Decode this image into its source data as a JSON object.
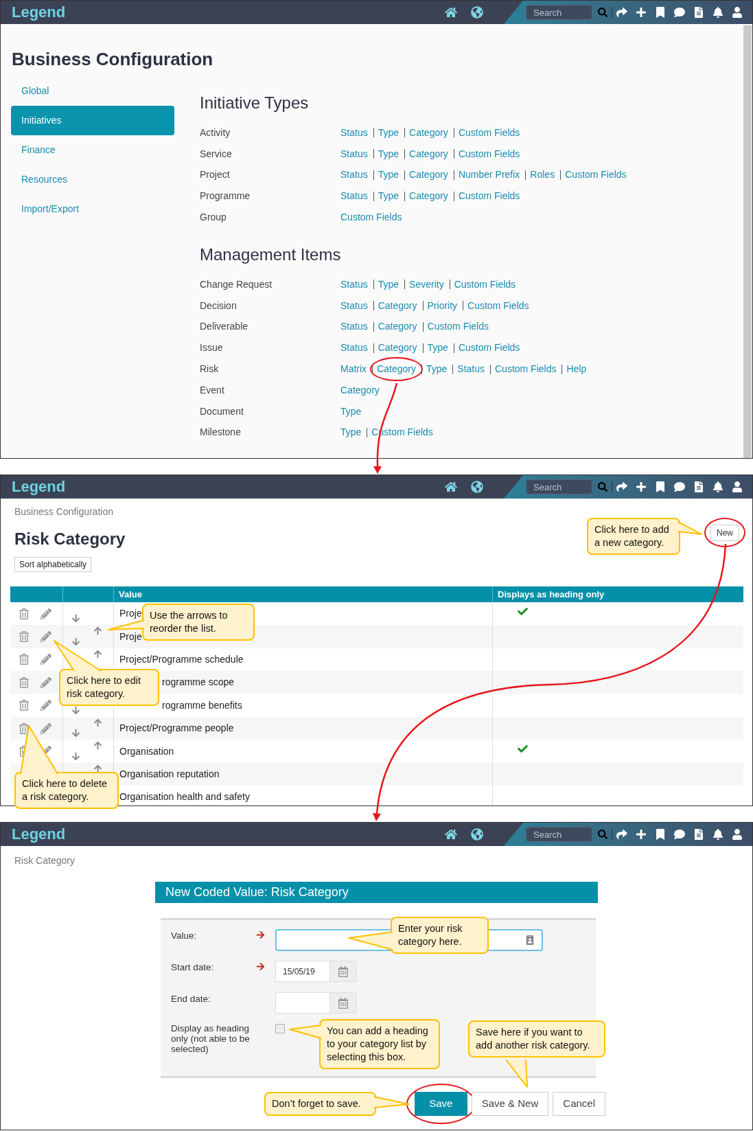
{
  "config_page": {
    "header": {
      "logo": "Legend",
      "search": {
        "placeholder": "Search"
      }
    },
    "title": "Business Configuration",
    "sidebar": {
      "items": [
        {
          "label": "Global",
          "selected": false
        },
        {
          "label": "Initiatives",
          "selected": true
        },
        {
          "label": "Finance",
          "selected": false
        },
        {
          "label": "Resources",
          "selected": false
        },
        {
          "label": "Import/Export",
          "selected": false
        }
      ]
    },
    "sections": [
      {
        "title": "Initiative Types",
        "rows": [
          {
            "label": "Activity",
            "links": [
              {
                "label": "Status",
                "circled": false
              },
              {
                "label": "Type",
                "circled": false
              },
              {
                "label": "Category",
                "circled": false
              },
              {
                "label": "Custom Fields",
                "circled": false
              }
            ]
          },
          {
            "label": "Service",
            "links": [
              {
                "label": "Status",
                "circled": false
              },
              {
                "label": "Type",
                "circled": false
              },
              {
                "label": "Category",
                "circled": false
              },
              {
                "label": "Custom Fields",
                "circled": false
              }
            ]
          },
          {
            "label": "Project",
            "links": [
              {
                "label": "Status",
                "circled": false
              },
              {
                "label": "Type",
                "circled": false
              },
              {
                "label": "Category",
                "circled": false
              },
              {
                "label": "Number Prefix",
                "circled": false
              },
              {
                "label": "Roles",
                "circled": false
              },
              {
                "label": "Custom Fields",
                "circled": false
              }
            ]
          },
          {
            "label": "Programme",
            "links": [
              {
                "label": "Status",
                "circled": false
              },
              {
                "label": "Type",
                "circled": false
              },
              {
                "label": "Category",
                "circled": false
              },
              {
                "label": "Custom Fields",
                "circled": false
              }
            ]
          },
          {
            "label": "Group",
            "links": [
              {
                "label": "Custom Fields",
                "circled": false
              }
            ]
          }
        ]
      },
      {
        "title": "Management Items",
        "rows": [
          {
            "label": "Change Request",
            "links": [
              {
                "label": "Status",
                "circled": false
              },
              {
                "label": "Type",
                "circled": false
              },
              {
                "label": "Severity",
                "circled": false
              },
              {
                "label": "Custom Fields",
                "circled": false
              }
            ]
          },
          {
            "label": "Decision",
            "links": [
              {
                "label": "Status",
                "circled": false
              },
              {
                "label": "Category",
                "circled": false
              },
              {
                "label": "Priority",
                "circled": false
              },
              {
                "label": "Custom Fields",
                "circled": false
              }
            ]
          },
          {
            "label": "Deliverable",
            "links": [
              {
                "label": "Status",
                "circled": false
              },
              {
                "label": "Category",
                "circled": false
              },
              {
                "label": "Custom Fields",
                "circled": false
              }
            ]
          },
          {
            "label": "Issue",
            "links": [
              {
                "label": "Status",
                "circled": false
              },
              {
                "label": "Category",
                "circled": false
              },
              {
                "label": "Type",
                "circled": false
              },
              {
                "label": "Custom Fields",
                "circled": false
              }
            ]
          },
          {
            "label": "Risk",
            "links": [
              {
                "label": "Matrix",
                "circled": false
              },
              {
                "label": "Category",
                "circled": true
              },
              {
                "label": "Type",
                "circled": false
              },
              {
                "label": "Status",
                "circled": false
              },
              {
                "label": "Custom Fields",
                "circled": false
              },
              {
                "label": "Help",
                "circled": false
              }
            ]
          },
          {
            "label": "Event",
            "links": [
              {
                "label": "Category",
                "circled": false
              }
            ]
          },
          {
            "label": "Document",
            "links": [
              {
                "label": "Type",
                "circled": false
              }
            ]
          },
          {
            "label": "Milestone",
            "links": [
              {
                "label": "Type",
                "circled": false
              },
              {
                "label": "Custom Fields",
                "circled": false
              }
            ]
          }
        ]
      }
    ]
  },
  "risk_category_page": {
    "header": {
      "logo": "Legend",
      "search": {
        "placeholder": "Search"
      }
    },
    "breadcrumb": "Business Configuration",
    "title": "Risk Category",
    "sort_button": "Sort alphabetically",
    "new_button": {
      "label": "New",
      "circled": true
    },
    "table": {
      "columns": [
        "Value",
        "Displays as heading only"
      ],
      "rows": [
        {
          "value": "Proje",
          "kind": "cut_end",
          "heading_only": true,
          "show_actions": true,
          "can_move_up": false,
          "can_move_down": true
        },
        {
          "value": "Proje",
          "kind": "cut_end",
          "heading_only": false,
          "show_actions": true,
          "can_move_up": true,
          "can_move_down": true
        },
        {
          "value": "Project/Programme schedule",
          "kind": "full",
          "heading_only": false,
          "show_actions": true,
          "can_move_up": true,
          "can_move_down": false
        },
        {
          "value": "rogramme scope",
          "kind": "cut_start",
          "heading_only": false,
          "show_actions": true
        },
        {
          "value": "rogramme benefits",
          "kind": "cut_start",
          "heading_only": false,
          "show_actions": true,
          "can_move_up": false,
          "can_move_down": true
        },
        {
          "value": "Project/Programme people",
          "kind": "full",
          "heading_only": false,
          "show_actions": true,
          "can_move_up": true,
          "can_move_down": true
        },
        {
          "value": "Organisation",
          "kind": "full",
          "heading_only": true,
          "show_actions": true,
          "can_move_up": true,
          "can_move_down": true
        },
        {
          "value": "Organisation reputation",
          "kind": "full",
          "heading_only": false,
          "show_actions": false,
          "can_move_up": true,
          "can_move_down": false
        },
        {
          "value": "Organisation health and safety",
          "kind": "full",
          "heading_only": false
        }
      ]
    },
    "callouts": [
      {
        "text": "Click here to add a new category."
      },
      {
        "text": "Use the arrows to reorder the list."
      },
      {
        "text": "Click here to edit risk category."
      },
      {
        "text": "Click here to delete a risk category."
      }
    ]
  },
  "new_value_page": {
    "header": {
      "logo": "Legend",
      "search": {
        "placeholder": "Search"
      }
    },
    "breadcrumb": "Risk Category",
    "dialog_title": "New Coded Value: Risk Category",
    "fields": [
      {
        "kind": "text",
        "label": "Value:",
        "required": true,
        "focused": true
      },
      {
        "kind": "date",
        "label": "Start date:",
        "required": true,
        "value": "15/05/19"
      },
      {
        "kind": "date",
        "label": "End date:",
        "required": false
      },
      {
        "kind": "checkbox",
        "label": "Display as heading only (not able to be selected)",
        "required": false,
        "checked": false
      }
    ],
    "buttons": [
      {
        "label": "Save",
        "primary": true,
        "circled": true
      },
      {
        "label": "Save & New",
        "primary": false,
        "circled": false
      },
      {
        "label": "Cancel",
        "primary": false,
        "circled": false
      }
    ],
    "callouts": [
      {
        "text": "Enter your risk category here."
      },
      {
        "text": "You can add a heading to your category list by selecting this box."
      },
      {
        "text": "Save here if you want to add another risk category."
      },
      {
        "text": "Don’t forget to save."
      }
    ]
  }
}
